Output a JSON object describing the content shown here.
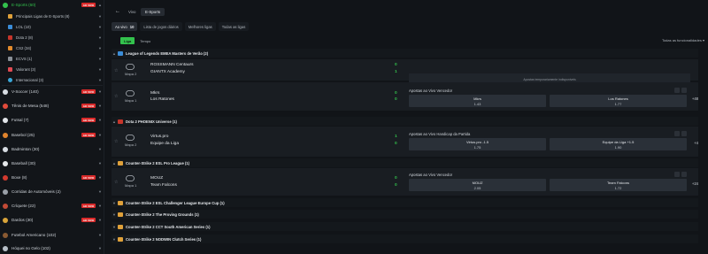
{
  "sidebar": {
    "esports": {
      "label": "E-Sports (60)",
      "live": "AO VIVO"
    },
    "sub_items": [
      {
        "label": "Principais Ligas de E-Sports (8)"
      },
      {
        "label": "LOL (10)"
      },
      {
        "label": "Dota 2 (8)"
      },
      {
        "label": "CS2 (34)"
      },
      {
        "label": "ECVS (1)"
      },
      {
        "label": "Valorant (3)"
      },
      {
        "label": "Internacional (3)"
      }
    ],
    "sports": [
      {
        "label": "V-Soccer (140)",
        "live": "AO VIVO"
      },
      {
        "label": "Tênis de Mesa (548)",
        "live": "AO VIVO"
      },
      {
        "label": "Futsal (7)",
        "live": "AO VIVO"
      },
      {
        "label": "Basebol (25)",
        "live": "AO VIVO"
      },
      {
        "label": "Badminton (30)",
        "live": ""
      },
      {
        "label": "Baseball (30)",
        "live": ""
      },
      {
        "label": "Boxe (8)",
        "live": "AO VIVO"
      },
      {
        "label": "Corridas de Automóveis (2)",
        "live": ""
      },
      {
        "label": "Críquete (22)",
        "live": "AO VIVO"
      },
      {
        "label": "Dardos (30)",
        "live": "AO VIVO"
      },
      {
        "label": "Futebol Americano (102)",
        "live": ""
      },
      {
        "label": "Hóquei no Gelo (102)",
        "live": ""
      }
    ]
  },
  "breadcrumb": {
    "back": "←",
    "item1": "Vivo",
    "item2": "E-Sports"
  },
  "tabs": [
    {
      "label": "Ao vivo",
      "count": "10"
    },
    {
      "label": "Lista de jogos diários",
      "count": ""
    },
    {
      "label": "Melhores ligas",
      "count": ""
    },
    {
      "label": "Todas as ligas",
      "count": ""
    }
  ],
  "subtabs": [
    {
      "label": "Liga"
    },
    {
      "label": "Tempo"
    }
  ],
  "functions_label": "Todas as funcionalidades",
  "leagues": [
    {
      "name": "League of Legends EMEA Masters de Verão (2)"
    },
    {
      "name": "Dota 2 PHOENIX Universe (1)"
    },
    {
      "name": "Counter-Strike 2 ESL Pro League (1)"
    },
    {
      "name": "Counter-Strike 2 ESL Challenger League Europe Cup (1)"
    },
    {
      "name": "Counter-Strike 2 The Proving Grounds (1)"
    },
    {
      "name": "Counter-Strike 2 CCT South American Series (1)"
    },
    {
      "name": "Counter-Strike 2 NODWIN Clutch Series (1)"
    }
  ],
  "matches": [
    {
      "map": "Mapa 2",
      "team1": "ROSSMANN Centaurs",
      "team2": "GIANTX Academy",
      "score1": "0",
      "score2": "1",
      "unavailable": "Apostas temporariamente indisponíveis"
    },
    {
      "map": "Mapa 1",
      "team1": "Mkrs",
      "team2": "Los Ratones",
      "score1": "0",
      "score2": "0",
      "market": "Apostas ao Vivo Vencedor",
      "odd1_name": "Mkrs",
      "odd1_val": "1.43",
      "odd2_name": "Los Ratones",
      "odd2_val": "1.77",
      "more": "+48"
    },
    {
      "map": "Mapa 2",
      "team1": "Virtus.pro",
      "team2": "Equipe da Liga",
      "score1": "1",
      "score2": "0",
      "market": "Apostas ao Vivo Handicap da Partida",
      "odd1_name": "Virtus.pro  -1.5",
      "odd1_val": "1.75",
      "odd2_name": "Equipe da Liga  +1.5",
      "odd2_val": "1.90",
      "more": "+4"
    },
    {
      "map": "Mapa 1",
      "team1": "MOUZ",
      "team2": "Team Falcons",
      "score1": "0",
      "score2": "0",
      "market": "Apostas ao Vivo Vencedor",
      "odd1_name": "MOUZ",
      "odd1_val": "2.05",
      "odd2_name": "Team Falcons",
      "odd2_val": "1.72",
      "more": "+24"
    }
  ],
  "colors": {
    "accent": "#33c24d",
    "live": "#d92a2a"
  }
}
